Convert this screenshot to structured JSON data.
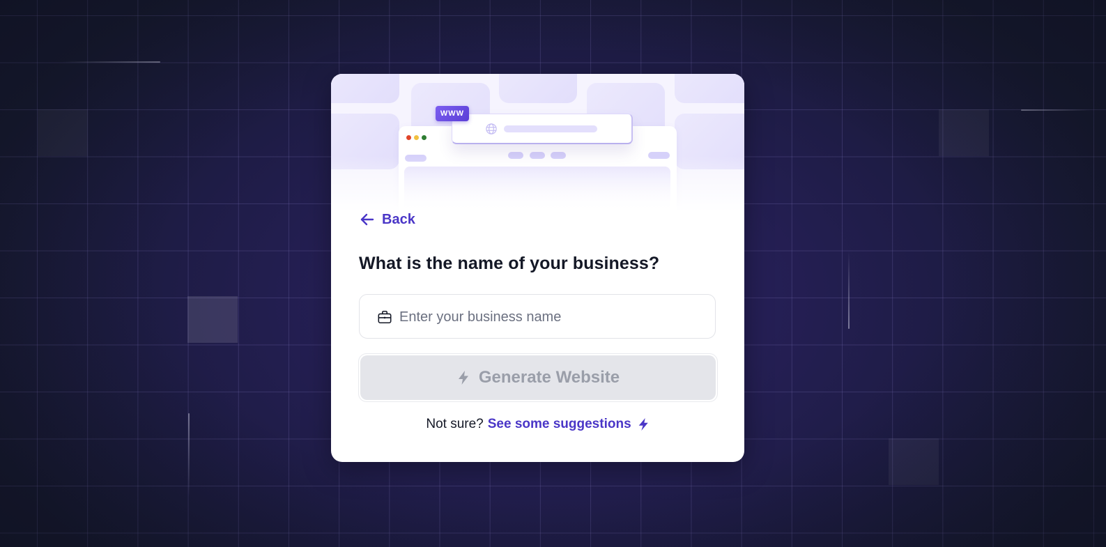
{
  "colors": {
    "accent": "#4a36c7",
    "badge": "#5b3fd6",
    "disabled_bg": "#e4e5ea",
    "disabled_text": "#9a9ea9",
    "heading": "#141826",
    "background": "#231f4f"
  },
  "illustration": {
    "badge_text": "WWW",
    "globe_icon": "globe-icon",
    "window_dots": [
      "#e0442a",
      "#f1c040",
      "#2e7d32"
    ]
  },
  "back": {
    "label": "Back",
    "icon": "arrow-left-icon"
  },
  "question": "What is the name of your business?",
  "business_input": {
    "value": "",
    "placeholder": "Enter your business name",
    "icon": "briefcase-icon"
  },
  "generate_button": {
    "label": "Generate Website",
    "icon": "lightning-icon",
    "state": "disabled"
  },
  "suggestions": {
    "prompt": "Not sure?",
    "link_label": "See some suggestions",
    "icon": "lightning-icon"
  }
}
